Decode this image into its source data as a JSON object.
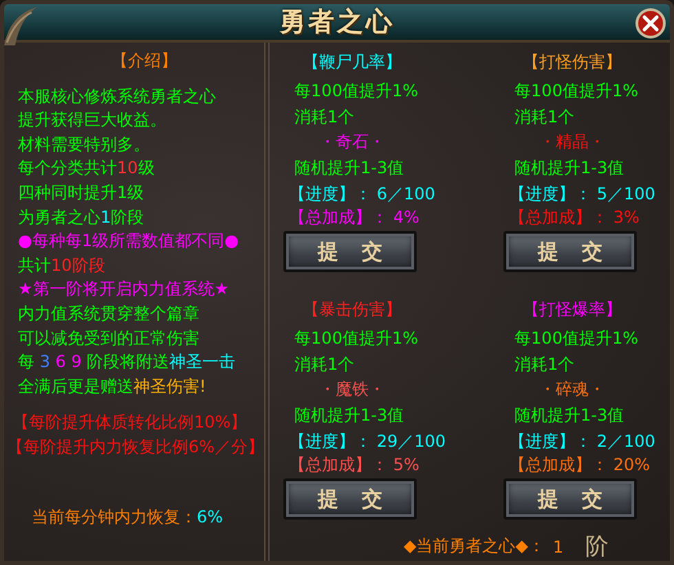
{
  "window": {
    "title": "勇者之心"
  },
  "intro": {
    "title": {
      "text": "【介绍】",
      "color": "#ff8000"
    },
    "lines": [
      [
        {
          "text": "本服核心修炼系统勇者之心",
          "color": "#00ff00"
        }
      ],
      [
        {
          "text": "提升获得巨大收益。",
          "color": "#00ff00"
        }
      ],
      [
        {
          "text": "材料需要特别多。",
          "color": "#00ff00"
        }
      ],
      [
        {
          "text": "每个分类共计",
          "color": "#00ff00"
        },
        {
          "text": "10",
          "color": "#ff3030"
        },
        {
          "text": "级",
          "color": "#00ff00"
        }
      ],
      [
        {
          "text": "四种同时提升1级",
          "color": "#00ff00"
        }
      ],
      [
        {
          "text": "为勇者之心",
          "color": "#00ff00"
        },
        {
          "text": "1",
          "color": "#00ffff"
        },
        {
          "text": "阶段",
          "color": "#00ff00"
        }
      ],
      [
        {
          "text": "●每种每1级所需数值都不同●",
          "color": "#ff00ff"
        }
      ],
      [
        {
          "text": "共计",
          "color": "#00ff00"
        },
        {
          "text": "10阶段",
          "color": "#ff2020"
        }
      ],
      [
        {
          "text": "★第一阶将开启内力值系统★",
          "color": "#ff00ff"
        }
      ],
      [
        {
          "text": "内力值系统贯穿整个篇章",
          "color": "#00ff00"
        }
      ],
      [
        {
          "text": "可以减免受到的正常伤害",
          "color": "#00ff00"
        }
      ],
      [
        {
          "text": "每 ",
          "color": "#00ff00"
        },
        {
          "text": "3",
          "color": "#4080ff"
        },
        {
          "text": " 6 9 ",
          "color": "#ff00ff"
        },
        {
          "text": "阶段将附送",
          "color": "#00ff00"
        },
        {
          "text": "神圣一击",
          "color": "#00ffff"
        }
      ],
      [
        {
          "text": "全满后更是赠送",
          "color": "#00ff00"
        },
        {
          "text": "神圣伤害!",
          "color": "#ffb000"
        }
      ]
    ],
    "notes": [
      {
        "text": "【每阶提升体质转化比例10%】",
        "color": "#ff1010"
      },
      {
        "text": "【每阶提升内力恢复比例6%／分】",
        "color": "#ff1010"
      }
    ],
    "recovery": {
      "label": "当前每分钟内力恢复：",
      "value": "6%"
    }
  },
  "cards": [
    {
      "title": {
        "text": "【鞭尸几率】",
        "color": "#00ffff"
      },
      "lines": [
        "每100值提升1%",
        "消耗1个"
      ],
      "material": {
        "text": "・奇石・",
        "color": "#ff00ff"
      },
      "random": "随机提升1-3值",
      "progress_label": "【进度】",
      "progress_value": "： 6／100",
      "bonus": {
        "label": "【总加成】",
        "value": "： 4%",
        "color": "#ff00ff"
      },
      "button": "提 交"
    },
    {
      "title": {
        "text": "【打怪伤害】",
        "color": "#ffa020"
      },
      "lines": [
        "每100值提升1%",
        "消耗1个"
      ],
      "material": {
        "text": "・精晶・",
        "color": "#ff1010"
      },
      "random": "随机提升1-3值",
      "progress_label": "【进度】",
      "progress_value": "： 5／100",
      "bonus": {
        "label": "【总加成】",
        "value": "： 3%",
        "color": "#ff1010"
      },
      "button": "提 交"
    },
    {
      "title": {
        "text": "【暴击伤害】",
        "color": "#ff2020"
      },
      "lines": [
        "每100值提升1%",
        "消耗1个"
      ],
      "material": {
        "text": "・魔铁・",
        "color": "#ff5050"
      },
      "random": "随机提升1-3值",
      "progress_label": "【进度】",
      "progress_value": "： 29／100",
      "bonus": {
        "label": "【总加成】",
        "value": "： 5%",
        "color": "#ff5050"
      },
      "button": "提 交"
    },
    {
      "title": {
        "text": "【打怪爆率】",
        "color": "#ff00ff"
      },
      "lines": [
        "每100值提升1%",
        "消耗1个"
      ],
      "material": {
        "text": "・碎魂・",
        "color": "#ff7010"
      },
      "random": "随机提升1-3值",
      "progress_label": "【进度】",
      "progress_value": "： 2／100",
      "bonus": {
        "label": "【总加成】",
        "value": "： 20%",
        "color": "#ff7010"
      },
      "button": "提 交"
    }
  ],
  "footer": {
    "label": "◆当前勇者之心◆：",
    "value": "1",
    "unit": "阶"
  }
}
